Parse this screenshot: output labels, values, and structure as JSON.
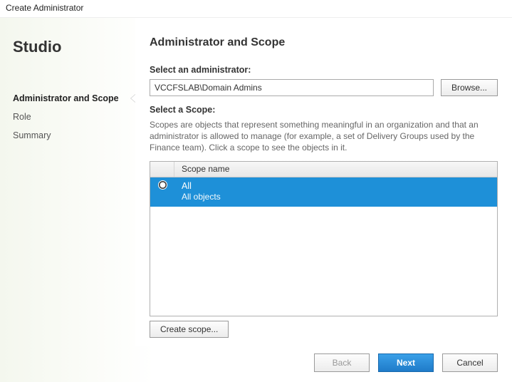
{
  "window": {
    "title": "Create Administrator"
  },
  "sidebar": {
    "app_name": "Studio",
    "steps": [
      {
        "label": "Administrator and Scope",
        "active": true
      },
      {
        "label": "Role",
        "active": false
      },
      {
        "label": "Summary",
        "active": false
      }
    ]
  },
  "page": {
    "title": "Administrator and Scope",
    "admin_label": "Select an administrator:",
    "admin_value": "VCCFSLAB\\Domain Admins",
    "browse_label": "Browse...",
    "scope_label": "Select a Scope:",
    "scope_desc": "Scopes are objects that represent something meaningful in an organization and that an administrator is allowed to manage (for example, a set of Delivery Groups used by the Finance team). Click a scope to see the objects in it.",
    "scope_header": "Scope name",
    "scopes": [
      {
        "name": "All",
        "detail": "All objects",
        "selected": true
      }
    ],
    "create_scope_label": "Create scope..."
  },
  "footer": {
    "back": "Back",
    "next": "Next",
    "cancel": "Cancel"
  }
}
